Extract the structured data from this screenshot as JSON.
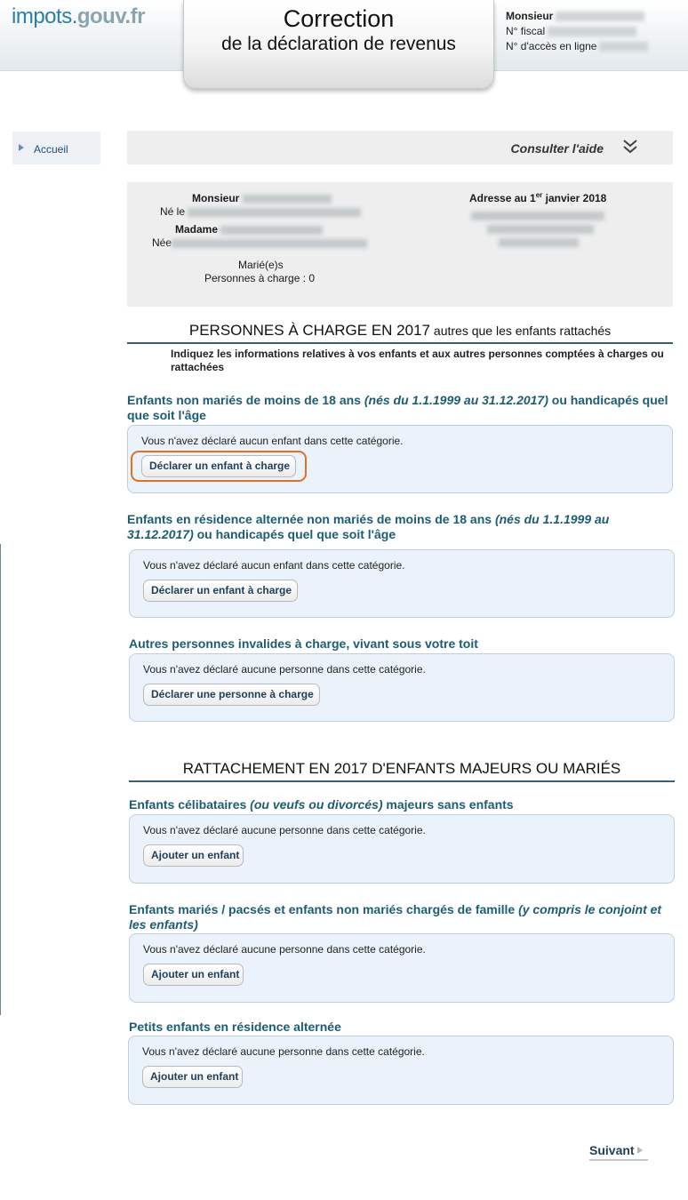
{
  "header": {
    "logo_part1": "impots.",
    "logo_part2": "gouv.fr",
    "title_line1": "Correction",
    "title_line2": "de la déclaration de revenus",
    "user_label": "Monsieur",
    "fiscal_label": "N° fiscal",
    "access_label": "N° d'accès en ligne"
  },
  "nav": {
    "home_label": "Accueil"
  },
  "help": {
    "label": "Consulter l'aide",
    "icon": "chevron-double-down-icon"
  },
  "identity": {
    "monsieur_label": "Monsieur",
    "born_label_m": "Né le",
    "madame_label": "Madame",
    "born_label_f": "Née",
    "status": "Marié(e)s",
    "dependents": "Personnes à charge : 0",
    "address_label_pre": "Adresse au 1",
    "address_label_sup": "er",
    "address_label_post": " janvier 2018"
  },
  "section1": {
    "title": "PERSONNES À CHARGE EN 2017",
    "title_small": " autres que les enfants rattachés",
    "instructions": "Indiquez les informations relatives à vos enfants et aux autres personnes comptées à charges ou rattachées",
    "cat1_title_a": "Enfants non mariés de moins de 18 ans ",
    "cat1_title_em": "(nés du 1.1.1999 au 31.12.2017)",
    "cat1_title_b": " ou handicapés quel que soit l'âge",
    "cat1_msg": "Vous n'avez déclaré aucun enfant dans cette catégorie.",
    "cat1_btn": "Déclarer un enfant à charge",
    "cat2_title_a": "Enfants en résidence alternée non mariés de moins de 18 ans ",
    "cat2_title_em": "(nés du 1.1.1999 au 31.12.2017)",
    "cat2_title_b": " ou handicapés quel que soit l'âge",
    "cat2_msg": "Vous n'avez déclaré aucun enfant dans cette catégorie.",
    "cat2_btn": "Déclarer un enfant à charge",
    "cat3_title": "Autres personnes invalides à charge, vivant sous votre toit",
    "cat3_msg": "Vous n'avez déclaré aucune personne dans cette catégorie.",
    "cat3_btn": "Déclarer une personne à charge"
  },
  "section2": {
    "title": "RATTACHEMENT EN 2017 D'ENFANTS MAJEURS OU MARIÉS",
    "cat1_title_a": "Enfants célibataires ",
    "cat1_title_em": "(ou veufs ou divorcés)",
    "cat1_title_b": " majeurs sans enfants",
    "cat1_msg": "Vous n'avez déclaré aucune personne dans cette catégorie.",
    "cat1_btn": "Ajouter un enfant",
    "cat2_title_a": "Enfants mariés / pacsés et enfants non mariés chargés de famille ",
    "cat2_title_em": "(y compris le conjoint et les enfants)",
    "cat2_msg": "Vous n'avez déclaré aucune personne dans cette catégorie.",
    "cat2_btn": "Ajouter un enfant",
    "cat3_title": "Petits enfants en résidence alternée",
    "cat3_msg": "Vous n'avez déclaré aucune personne dans cette catégorie.",
    "cat3_btn": "Ajouter un enfant"
  },
  "footer": {
    "next_label": "Suivant"
  },
  "colors": {
    "accent": "#1b5d73",
    "focus": "#e2711d",
    "card_bg": "#eaf3fb"
  }
}
